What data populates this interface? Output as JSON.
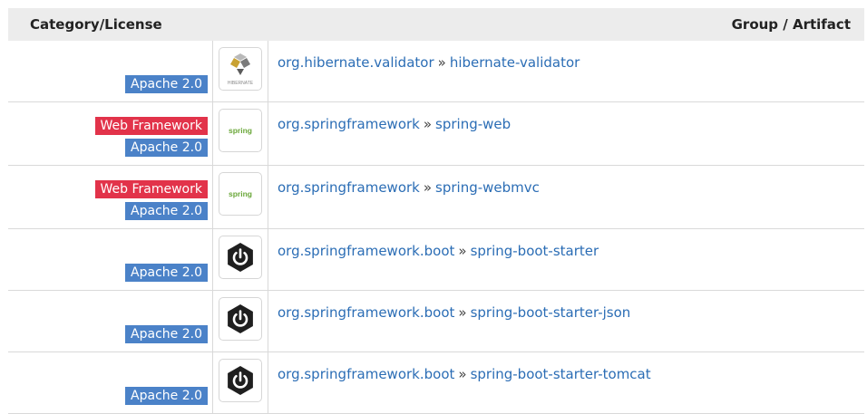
{
  "header": {
    "left": "Category/License",
    "right": "Group / Artifact"
  },
  "rows": [
    {
      "categories": [],
      "license": "Apache 2.0",
      "icon": "hibernate-icon",
      "group": "org.hibernate.validator",
      "separator": "»",
      "artifact": "hibernate-validator",
      "logo_text": "HIBERNATE"
    },
    {
      "categories": [
        "Web Framework"
      ],
      "license": "Apache 2.0",
      "icon": "spring-icon",
      "group": "org.springframework",
      "separator": "»",
      "artifact": "spring-web",
      "logo_text": "spring"
    },
    {
      "categories": [
        "Web Framework"
      ],
      "license": "Apache 2.0",
      "icon": "spring-icon",
      "group": "org.springframework",
      "separator": "»",
      "artifact": "spring-webmvc",
      "logo_text": "spring"
    },
    {
      "categories": [],
      "license": "Apache 2.0",
      "icon": "spring-boot-icon",
      "group": "org.springframework.boot",
      "separator": "»",
      "artifact": "spring-boot-starter"
    },
    {
      "categories": [],
      "license": "Apache 2.0",
      "icon": "spring-boot-icon",
      "group": "org.springframework.boot",
      "separator": "»",
      "artifact": "spring-boot-starter-json"
    },
    {
      "categories": [],
      "license": "Apache 2.0",
      "icon": "spring-boot-icon",
      "group": "org.springframework.boot",
      "separator": "»",
      "artifact": "spring-boot-starter-tomcat"
    }
  ],
  "colors": {
    "license_badge": "#4b82c8",
    "category_badge": "#e2334a",
    "link": "#2b6db5",
    "header_bg": "#ececec"
  }
}
